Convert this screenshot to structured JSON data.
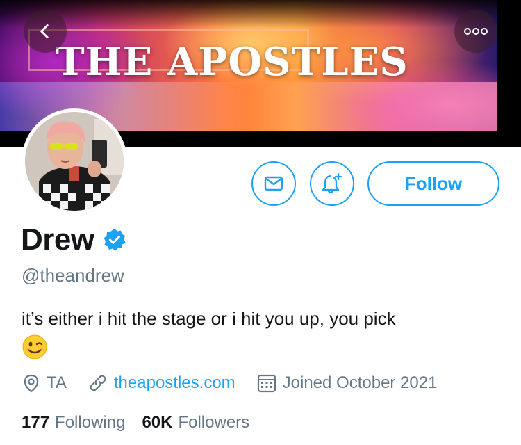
{
  "header": {
    "banner_title": "THE APOSTLES"
  },
  "icons": {
    "back": "chevron-left-icon",
    "more": "more-dots-icon",
    "message": "envelope-icon",
    "notify": "bell-plus-icon",
    "verified": "verified-badge-icon",
    "location": "location-pin-icon",
    "link": "link-icon",
    "calendar": "calendar-icon"
  },
  "profile": {
    "display_name": "Drew",
    "handle": "@theandrew",
    "bio": "it’s either i hit the stage or i hit you up, you pick",
    "bio_emoji": "😉",
    "location": "TA",
    "website": "theapostles.com",
    "joined": "Joined October 2021"
  },
  "actions": {
    "follow_label": "Follow"
  },
  "stats": {
    "following_count": "177",
    "following_label": "Following",
    "followers_count": "60K",
    "followers_label": "Followers"
  },
  "colors": {
    "accent": "#1da1f2",
    "secondary_text": "#657786",
    "primary_text": "#14171a"
  }
}
